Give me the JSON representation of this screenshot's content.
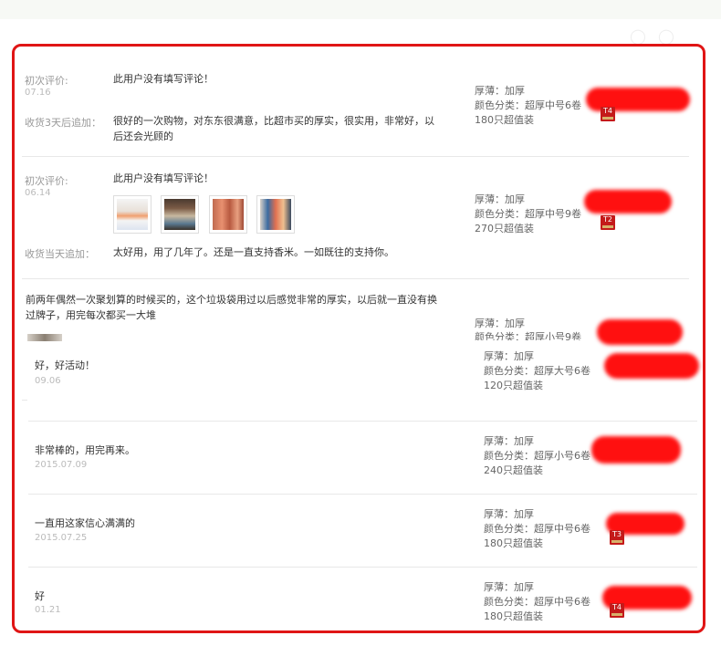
{
  "reviews": [
    {
      "initial_label": "初次评价:",
      "initial_date": "07.16",
      "initial_text": "此用户没有填写评论！",
      "append_label": "收货3天后追加：",
      "append_text": "很好的一次购物，对东东很满意，比超市买的厚实，很实用，非常好，以后还会光顾的",
      "thickness": "厚薄：加厚",
      "color": "颜色分类：超厚中号6卷",
      "pack": "180只超值装",
      "badge": "T4"
    },
    {
      "initial_label": "初次评价:",
      "initial_date": "06.14",
      "initial_text": "此用户没有填写评论！",
      "append_label": "收货当天追加：",
      "append_text": "太好用，用了几年了。还是一直支持香米。一如既往的支持你。",
      "thickness": "厚薄：加厚",
      "color": "颜色分类：超厚中号9卷",
      "pack": "270只超值装",
      "badge": "T2"
    },
    {
      "text": "前两年偶然一次聚划算的时候买的，这个垃圾袋用过以后感觉非常的厚实，以后就一直没有换过牌子，用完每次都买一大堆",
      "thickness": "厚薄：加厚",
      "color": "颜色分类：超厚小号9卷"
    },
    {
      "text": "好，好活动！",
      "date": "09.06",
      "thickness": "厚薄：加厚",
      "color": "颜色分类：超厚大号6卷",
      "pack": "120只超值装"
    },
    {
      "text": "非常棒的，用完再来。",
      "date": "2015.07.09",
      "thickness": "厚薄：加厚",
      "color": "颜色分类：超厚小号6卷",
      "pack": "240只超值装"
    },
    {
      "text": "一直用这家信心满满的",
      "date": "2015.07.25",
      "thickness": "厚薄：加厚",
      "color": "颜色分类：超厚中号6卷",
      "pack": "180只超值装",
      "badge": "T3"
    },
    {
      "text": "好",
      "date": "01.21",
      "thickness": "厚薄：加厚",
      "color": "颜色分类：超厚中号6卷",
      "pack": "180只超值装",
      "badge": "T4"
    }
  ],
  "colors": {
    "highlight_border": "#e01515",
    "redaction": "#ff1010",
    "badge": "#c41a1a"
  }
}
